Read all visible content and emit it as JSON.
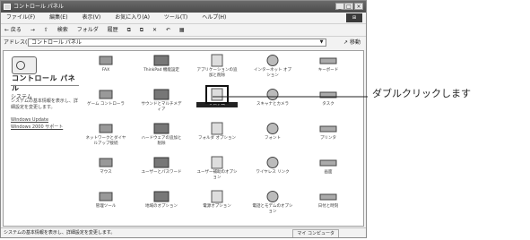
{
  "window": {
    "title": "コントロール パネル",
    "buttons": [
      "_",
      "□",
      "×"
    ]
  },
  "menu": [
    "ファイル(F)",
    "編集(E)",
    "表示(V)",
    "お気に入り(A)",
    "ツール(T)",
    "ヘルプ(H)"
  ],
  "toolbar": {
    "back": "← 戻る",
    "forward": "→",
    "up": "⇧",
    "search": "検索",
    "folders": "フォルダ",
    "history": "履歴"
  },
  "address": {
    "label": "アドレス(D)",
    "value": "コントロール パネル",
    "go": "移動"
  },
  "left": {
    "title": "コントロール パネル",
    "section_title": "システム",
    "section_desc": "システムの基本情報を表示し、詳細設定を変更します。",
    "links": [
      "Windows Update",
      "Windows 2000 サポート"
    ]
  },
  "items": [
    {
      "label": "FAX",
      "icon": "fax-icon"
    },
    {
      "label": "ThinkPad 機能設定",
      "icon": "thinkpad-icon"
    },
    {
      "label": "アプリケーションの追加と削除",
      "icon": "add-remove-programs-icon"
    },
    {
      "label": "インターネット オプション",
      "icon": "internet-options-icon"
    },
    {
      "label": "キーボード",
      "icon": "keyboard-icon"
    },
    {
      "label": "ゲーム コントローラ",
      "icon": "game-controller-icon"
    },
    {
      "label": "サウンドとマルチメディア",
      "icon": "sound-icon"
    },
    {
      "label": "システム",
      "icon": "system-icon",
      "selected": true
    },
    {
      "label": "スキャナとカメラ",
      "icon": "scanner-camera-icon"
    },
    {
      "label": "タスク",
      "icon": "scheduled-tasks-icon"
    },
    {
      "label": "ネットワークとダイヤルアップ接続",
      "icon": "network-icon"
    },
    {
      "label": "ハードウェアの追加と削除",
      "icon": "add-hardware-icon"
    },
    {
      "label": "フォルダ オプション",
      "icon": "folder-options-icon"
    },
    {
      "label": "フォント",
      "icon": "fonts-icon"
    },
    {
      "label": "プリンタ",
      "icon": "printers-icon"
    },
    {
      "label": "マウス",
      "icon": "mouse-icon"
    },
    {
      "label": "ユーザーとパスワード",
      "icon": "users-passwords-icon"
    },
    {
      "label": "ユーザー補助のオプション",
      "icon": "accessibility-icon"
    },
    {
      "label": "ワイヤレス リンク",
      "icon": "wireless-link-icon"
    },
    {
      "label": "画面",
      "icon": "display-icon"
    },
    {
      "label": "管理ツール",
      "icon": "admin-tools-icon"
    },
    {
      "label": "地域のオプション",
      "icon": "regional-options-icon"
    },
    {
      "label": "電源オプション",
      "icon": "power-options-icon"
    },
    {
      "label": "電話とモデムのオプション",
      "icon": "phone-modem-icon"
    },
    {
      "label": "日付と時刻",
      "icon": "date-time-icon"
    }
  ],
  "status": {
    "text": "システムの基本情報を表示し、詳細設定を変更します。",
    "zone": "マイ コンピュータ"
  },
  "callout": "ダブルクリックします"
}
